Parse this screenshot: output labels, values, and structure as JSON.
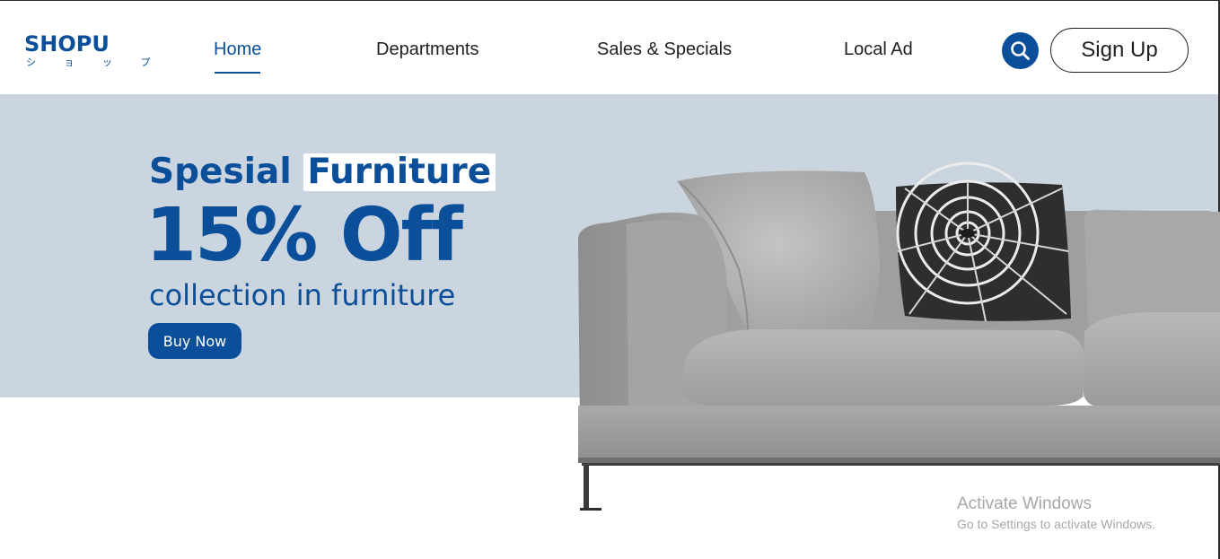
{
  "logo": {
    "name": "SHOPU",
    "subtitle": "シ ョ ッ プ"
  },
  "nav": {
    "items": [
      {
        "label": "Home",
        "active": true
      },
      {
        "label": "Departments",
        "active": false
      },
      {
        "label": "Sales & Specials",
        "active": false
      },
      {
        "label": "Local Ad",
        "active": false
      }
    ]
  },
  "header": {
    "search_icon": "search-icon",
    "signup_label": "Sign Up"
  },
  "hero": {
    "headline_prefix": "Spesial",
    "headline_highlight": "Furniture",
    "discount": "15% Off",
    "subline": "collection in furniture",
    "cta_label": "Buy Now",
    "image": "grey-sofa-with-patterned-pillow"
  },
  "watermark": {
    "title": "Activate Windows",
    "subtitle": "Go to Settings to activate Windows."
  },
  "colors": {
    "brand": "#0b4f9a",
    "hero_bg": "#cad5df",
    "text": "#1f1f1f",
    "watermark": "#a7a7a7"
  }
}
